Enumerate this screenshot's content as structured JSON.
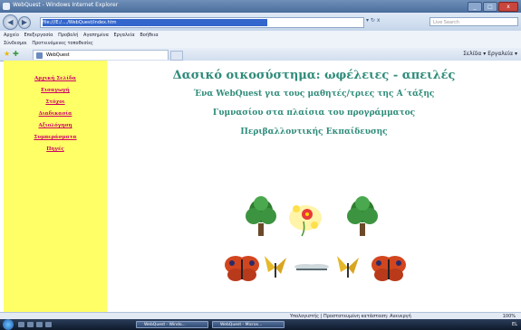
{
  "window": {
    "title": "WebQuest - Windows Internet Explorer",
    "min_label": "_",
    "max_label": "□",
    "close_label": "x"
  },
  "address": {
    "back_label": "◀",
    "forward_label": "▶",
    "url": "file:///E:/..../WebQuest/index.htm",
    "controls": "▾  ↻  x",
    "search_placeholder": "Live Search"
  },
  "menubar": [
    "Αρχείο",
    "Επεξεργασία",
    "Προβολή",
    "Αγαπημένα",
    "Εργαλεία",
    "Βοήθεια"
  ],
  "linksbar": [
    "Σύνδεσμοι",
    "Προτεινόμενες τοποθεσίες"
  ],
  "tab": {
    "label": "WebQuest",
    "tools": "Σελίδα ▾   Εργαλεία ▾"
  },
  "sidebar": {
    "links": [
      "Αρχική Σελίδα",
      "Εισαγωγή",
      "Στόχοι",
      "Διαδικασία",
      "Αξιολόγηση",
      "Συμπεράσματα",
      "Πηγές"
    ]
  },
  "content": {
    "title": "Δασικό οικοσύστημα: ωφέλειες - απειλές",
    "subtitle_lines": [
      "Ένα WebQuest για τους μαθητές/τριες της Α΄τάξης",
      "Γυμνασίου στα πλαίσια του προγράμματος",
      "Περιβαλλοντικής Εκπαίδευσης"
    ]
  },
  "statusbar": {
    "status": "Υπολογιστής | Προστατευμένη κατάσταση: Ανενεργή",
    "zoom": "100%"
  },
  "taskbar": {
    "items": [
      "WebQuest - Windo...",
      "WebQuest - Micros..."
    ],
    "clock": "EL"
  }
}
